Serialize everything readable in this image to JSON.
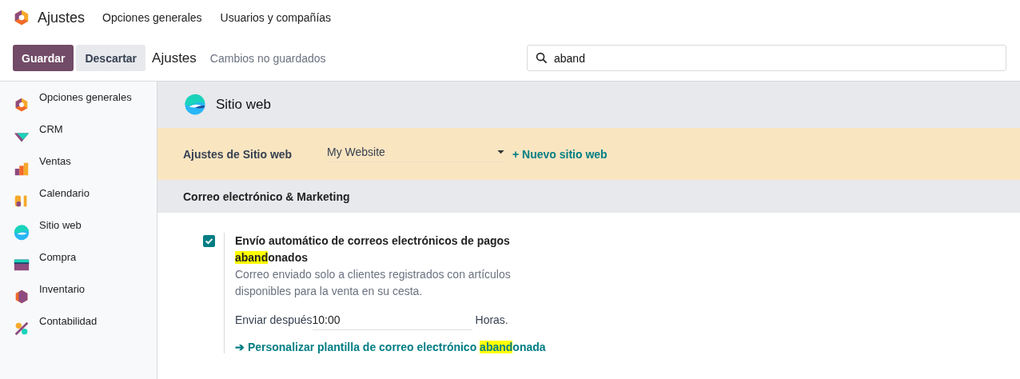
{
  "topbar": {
    "app": "Ajustes",
    "menu": [
      "Opciones generales",
      "Usuarios y compañías"
    ]
  },
  "controlbar": {
    "save": "Guardar",
    "discard": "Descartar",
    "breadcrumb": "Ajustes",
    "status": "Cambios no guardados",
    "search": {
      "value": "aband"
    }
  },
  "sidebar": {
    "items": [
      {
        "label": "Opciones generales",
        "selected": false
      },
      {
        "label": "CRM",
        "selected": false
      },
      {
        "label": "Ventas",
        "selected": false
      },
      {
        "label": "Calendario",
        "selected": false
      },
      {
        "label": "Sitio web",
        "selected": false
      },
      {
        "label": "Compra",
        "selected": false
      },
      {
        "label": "Inventario",
        "selected": false
      },
      {
        "label": "Contabilidad",
        "selected": false
      }
    ]
  },
  "app_header": {
    "title": "Sitio web"
  },
  "website_bar": {
    "label": "Ajustes de Sitio web",
    "value": "My Website",
    "new_link": "+ Nuevo sitio web"
  },
  "section": {
    "title": "Correo electrónico & Marketing"
  },
  "setting": {
    "checked": true,
    "title": [
      {
        "text": "Envío automático de correos electrónicos de pagos ",
        "highlighted": false
      },
      {
        "text": "aband",
        "highlighted": true
      },
      {
        "text": "onados",
        "highlighted": false
      }
    ],
    "description": "Correo enviado solo a clientes registrados con artículos disponibles para la venta en su cesta.",
    "delay_label": "Enviar después",
    "delay_value": "10:00",
    "delay_unit": "Horas.",
    "link_arrow": "➔",
    "link": [
      {
        "text": "Personalizar plantilla de correo electrónico ",
        "highlighted": false
      },
      {
        "text": "aband",
        "highlighted": true
      },
      {
        "text": "onada",
        "highlighted": false
      }
    ]
  }
}
